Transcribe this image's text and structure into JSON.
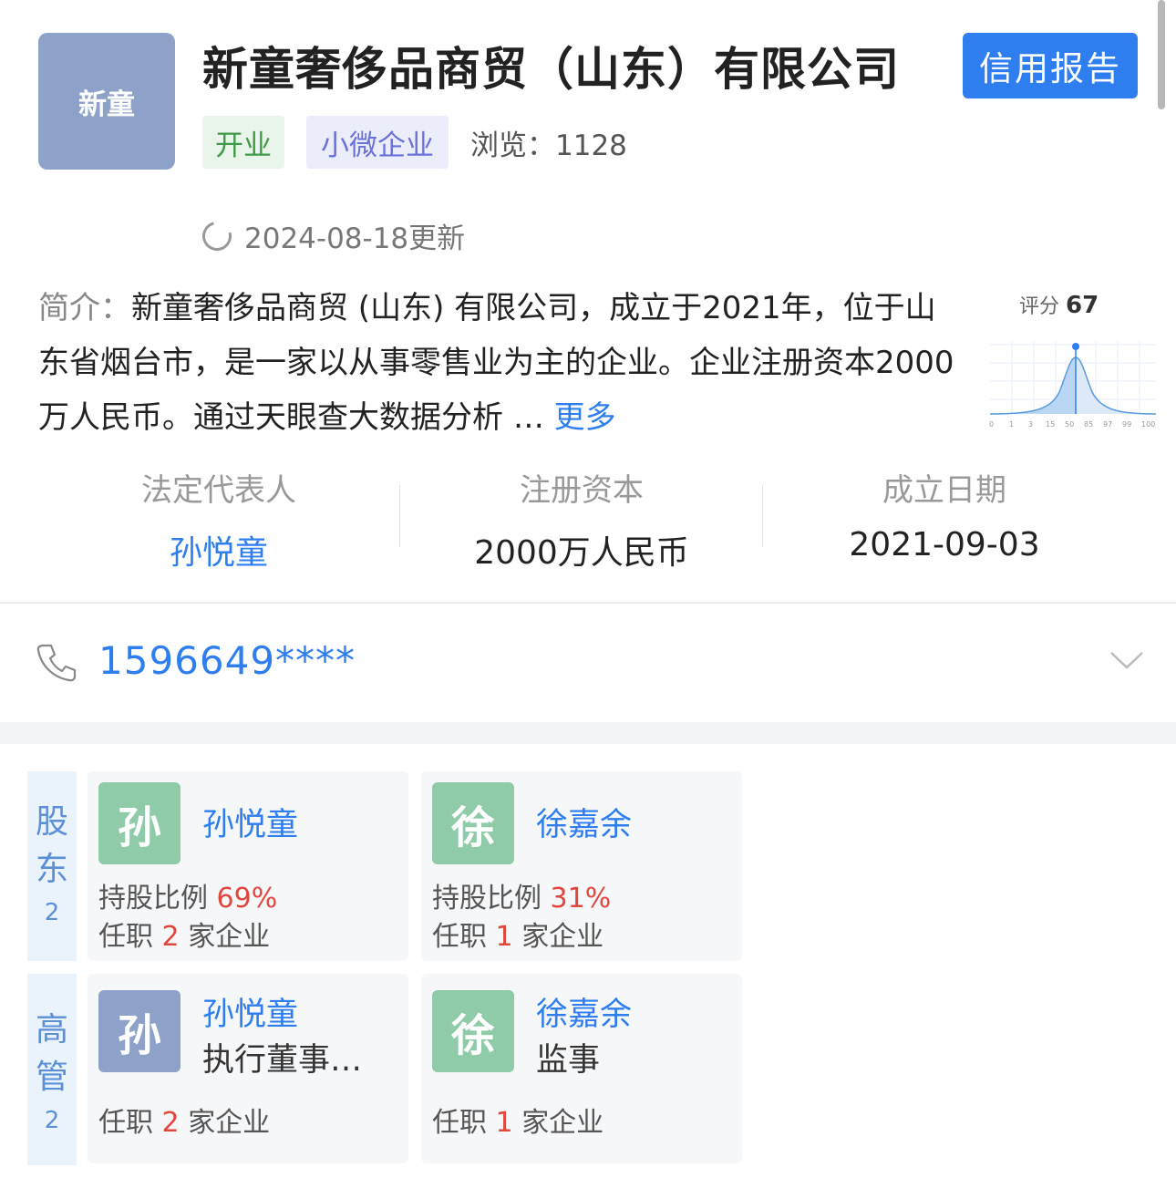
{
  "company": {
    "logo_text": "新童",
    "name": "新童奢侈品商贸（山东）有限公司",
    "credit_report_label": "信用报告",
    "tags": {
      "status": "开业",
      "size": "小微企业"
    },
    "views_label": "浏览：",
    "views_value": "1128",
    "update_text": "2024-08-18更新"
  },
  "intro": {
    "label": "简介：",
    "text": "新童奢侈品商贸 (山东) 有限公司，成立于2021年，位于山东省烟台市，是一家以从事零售业为主的企业。企业注册资本2000万人民币。通过天眼查大数据分析",
    "ellipsis": "…",
    "more_label": "更多"
  },
  "score": {
    "label": "评分",
    "value": "67",
    "ticks": [
      "0",
      "1",
      "3",
      "15",
      "50",
      "85",
      "97",
      "99",
      "100"
    ]
  },
  "key_info": {
    "legal_rep": {
      "label": "法定代表人",
      "value": "孙悦童"
    },
    "reg_capital": {
      "label": "注册资本",
      "value": "2000万人民币"
    },
    "founded": {
      "label": "成立日期",
      "value": "2021-09-03"
    }
  },
  "contact": {
    "phone": "1596649****"
  },
  "shareholders": {
    "label_chars": [
      "股",
      "东"
    ],
    "count": "2",
    "items": [
      {
        "avatar": "孙",
        "name": "孙悦童",
        "ratio_label": "持股比例",
        "ratio": "69%",
        "job_prefix": "任职",
        "job_count": "2",
        "job_suffix": "家企业"
      },
      {
        "avatar": "徐",
        "name": "徐嘉余",
        "ratio_label": "持股比例",
        "ratio": "31%",
        "job_prefix": "任职",
        "job_count": "1",
        "job_suffix": "家企业"
      }
    ]
  },
  "executives": {
    "label_chars": [
      "高",
      "管"
    ],
    "count": "2",
    "items": [
      {
        "avatar": "孙",
        "name": "孙悦童",
        "role": "执行董事…",
        "job_prefix": "任职",
        "job_count": "2",
        "job_suffix": "家企业"
      },
      {
        "avatar": "徐",
        "name": "徐嘉余",
        "role": "监事",
        "job_prefix": "任职",
        "job_count": "1",
        "job_suffix": "家企业"
      }
    ]
  },
  "colors": {
    "accent": "#2f7ef0",
    "open_green": "#3f9a47",
    "size_purple": "#6a72d8",
    "highlight_red": "#e0473e",
    "avatar_green": "#8fcaa9",
    "avatar_blue": "#8ea1c8"
  }
}
